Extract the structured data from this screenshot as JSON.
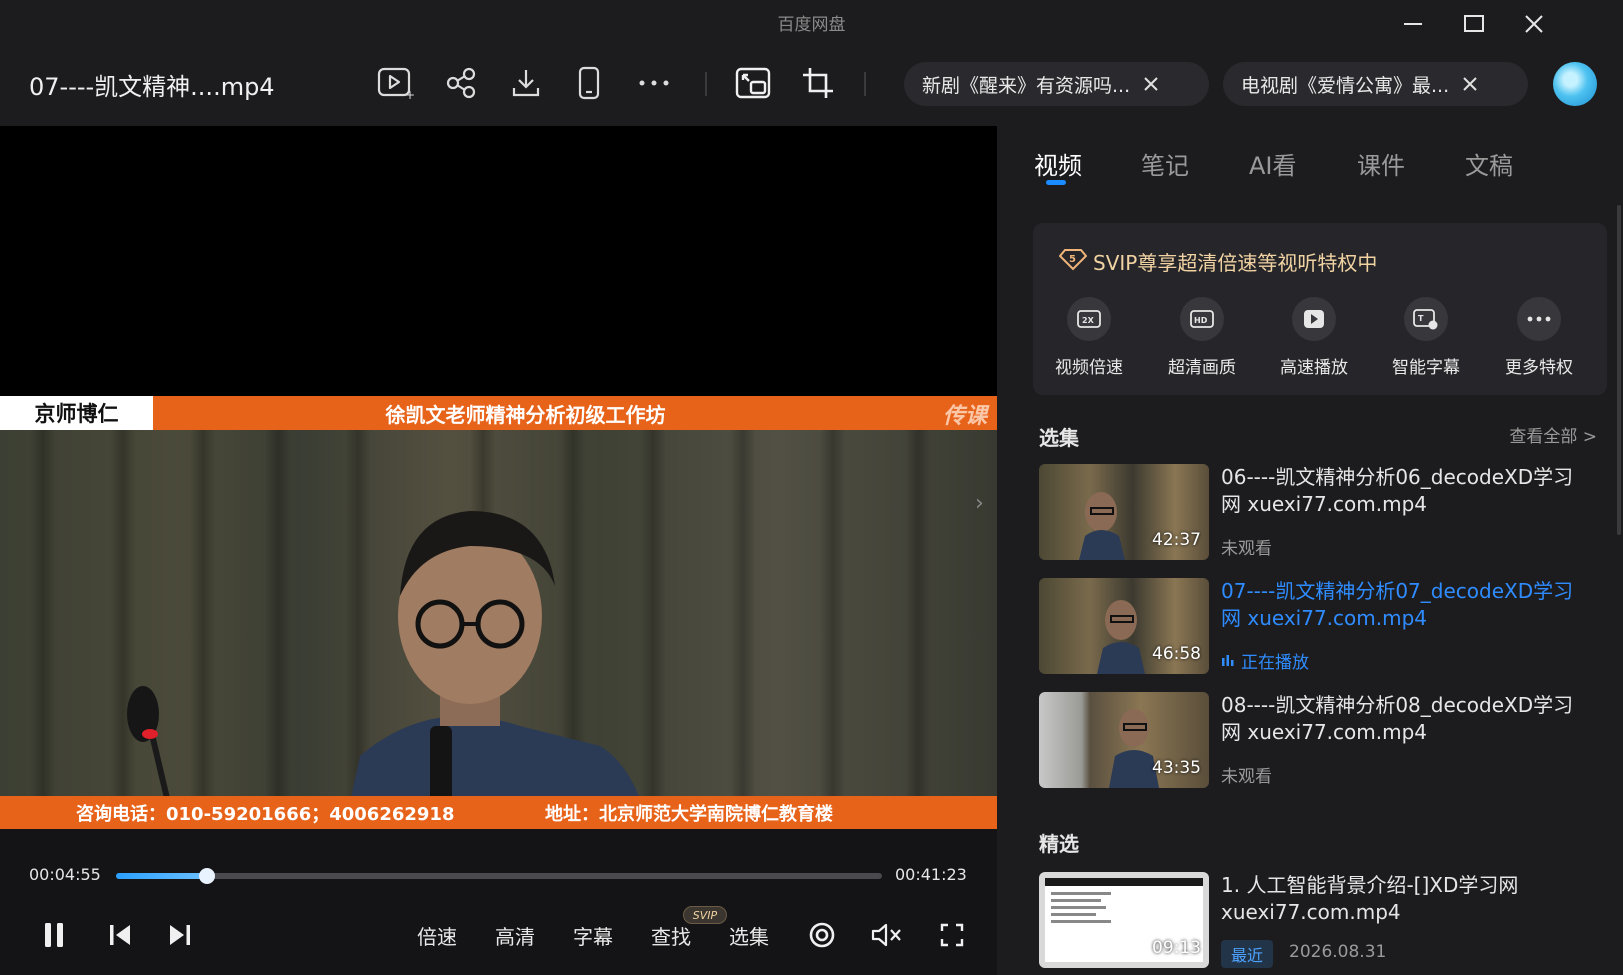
{
  "app": {
    "name": "百度网盘"
  },
  "window": {
    "minimize_icon": "minimize-icon",
    "maximize_icon": "maximize-icon",
    "close_icon": "close-icon"
  },
  "header": {
    "file_title": "07----凯文精神....mp4",
    "tools": [
      "play-list-icon",
      "share-icon",
      "download-icon",
      "phone-icon",
      "more-icon",
      "pip-icon",
      "crop-icon"
    ],
    "chips": [
      {
        "text": "新剧《醒来》有资源吗..."
      },
      {
        "text": "电视剧《爱情公寓》最..."
      }
    ]
  },
  "video": {
    "brand": "京师博仁",
    "course": "徐凯文老师精神分析初级工作坊",
    "watermark": "传课",
    "phone": "咨询电话：010-59201666；4006262918",
    "address": "地址：北京师范大学南院博仁教育楼"
  },
  "controls": {
    "current_time": "00:04:55",
    "total_time": "00:41:23",
    "progress": 0.119,
    "speed": "倍速",
    "quality": "高清",
    "subtitle": "字幕",
    "search": "查找",
    "search_badge": "SVIP",
    "episodes": "选集"
  },
  "sidebar": {
    "tabs": [
      "视频",
      "笔记",
      "AI看",
      "课件",
      "文稿"
    ],
    "active_tab": 0,
    "svip": {
      "title": "SVIP尊享超清倍速等视听特权中",
      "features": [
        "视频倍速",
        "超清画质",
        "高速播放",
        "智能字幕",
        "更多特权"
      ]
    },
    "episodes_title": "选集",
    "see_all": "查看全部 >",
    "episodes": [
      {
        "title": "06----凯文精神分析06_decodeXD学习网 xuexi77.com.mp4",
        "duration": "42:37",
        "status": "未观看",
        "playing": false
      },
      {
        "title": "07----凯文精神分析07_decodeXD学习网 xuexi77.com.mp4",
        "duration": "46:58",
        "status": "正在播放",
        "playing": true
      },
      {
        "title": "08----凯文精神分析08_decodeXD学习网 xuexi77.com.mp4",
        "duration": "43:35",
        "status": "未观看",
        "playing": false
      }
    ],
    "featured_title": "精选",
    "featured": [
      {
        "title": "1. 人工智能背景介绍-[]XD学习网 xuexi77.com.mp4",
        "duration": "09:13",
        "badge": "最近",
        "date": "2026.08.31"
      }
    ]
  },
  "colors": {
    "accent": "#1a8cff",
    "banner": "#e8631a",
    "svip_gold": "#f1d3a3"
  }
}
